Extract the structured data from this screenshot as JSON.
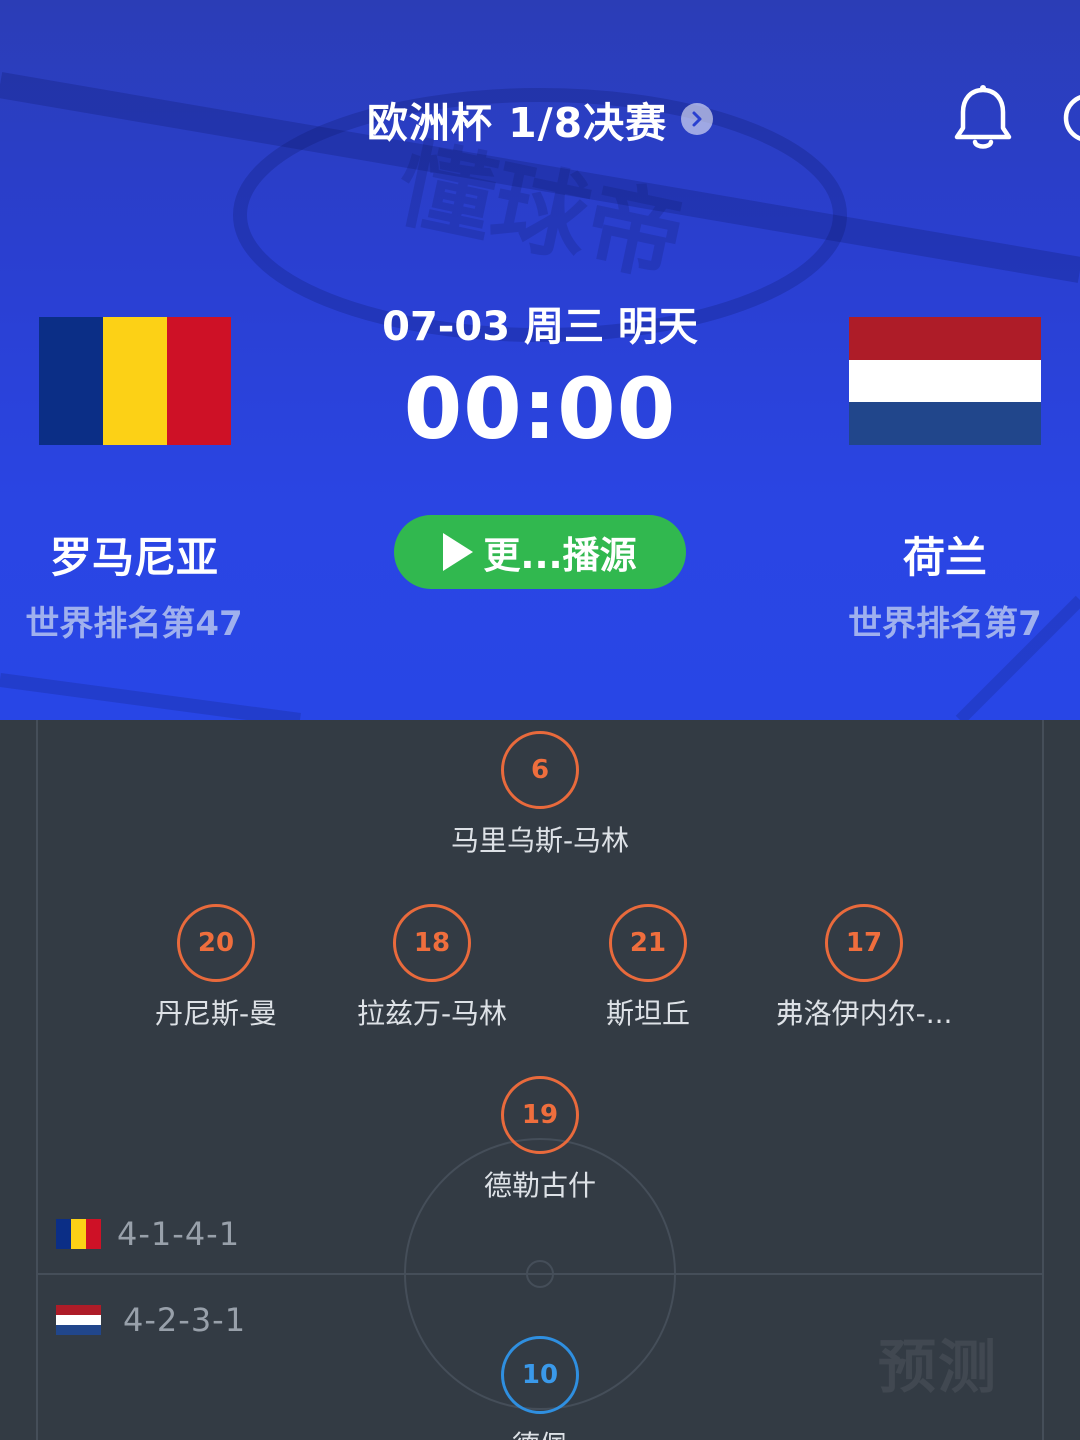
{
  "header": {
    "title": "欧洲杯 1/8决赛",
    "date": "07-03 周三 明天",
    "time": "00:00",
    "stream_button_label": "更...播源",
    "watermark": "懂球帝"
  },
  "home_team": {
    "name": "罗马尼亚",
    "rank": "世界排名第47",
    "flag_colors": [
      "#0b2e86",
      "#fcd116",
      "#ce1126"
    ]
  },
  "away_team": {
    "name": "荷兰",
    "rank": "世界排名第7",
    "flag_colors": [
      "#ae1c28",
      "#ffffff",
      "#21468b"
    ]
  },
  "lineup": {
    "home_players": [
      {
        "number": "6",
        "name": "马里乌斯-马林"
      },
      {
        "number": "20",
        "name": "丹尼斯-曼"
      },
      {
        "number": "18",
        "name": "拉兹万-马林"
      },
      {
        "number": "21",
        "name": "斯坦丘"
      },
      {
        "number": "17",
        "name": "弗洛伊内尔-..."
      },
      {
        "number": "19",
        "name": "德勒古什"
      }
    ],
    "away_players": [
      {
        "number": "10",
        "name": "德佩"
      }
    ],
    "home_formation": "4-1-4-1",
    "away_formation": "4-2-3-1",
    "prediction_label": "预测"
  },
  "icons": {
    "title_chevron": "chevron-right-icon",
    "bell": "bell-icon",
    "play": "play-icon"
  },
  "colors": {
    "header_blue": "#2a45e3",
    "pitch": "#333b44",
    "stream_green": "#31b84f",
    "home_badge": "#e96a3c",
    "away_badge": "#2f8fe0"
  }
}
